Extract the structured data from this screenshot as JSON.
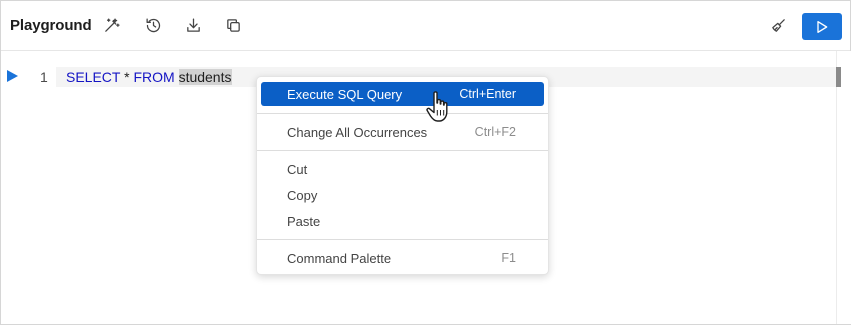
{
  "toolbar": {
    "title": "Playground",
    "icons": [
      "magic-wand-icon",
      "history-icon",
      "download-icon",
      "copy-icon"
    ],
    "right_icons": [
      "broom-icon",
      "play-icon"
    ]
  },
  "editor": {
    "line_number": "1",
    "code": {
      "kw1": "SELECT",
      "op": "*",
      "kw2": "FROM",
      "ident": "students"
    }
  },
  "context_menu": {
    "items": [
      {
        "label": "Execute SQL Query",
        "shortcut": "Ctrl+Enter"
      },
      {
        "label": "Change All Occurrences",
        "shortcut": "Ctrl+F2"
      },
      {
        "label": "Cut",
        "shortcut": ""
      },
      {
        "label": "Copy",
        "shortcut": ""
      },
      {
        "label": "Paste",
        "shortcut": ""
      },
      {
        "label": "Command Palette",
        "shortcut": "F1"
      }
    ]
  },
  "colors": {
    "accent": "#1a73d9",
    "menu_highlight": "#0b5fc6",
    "keyword": "#1515c4"
  }
}
